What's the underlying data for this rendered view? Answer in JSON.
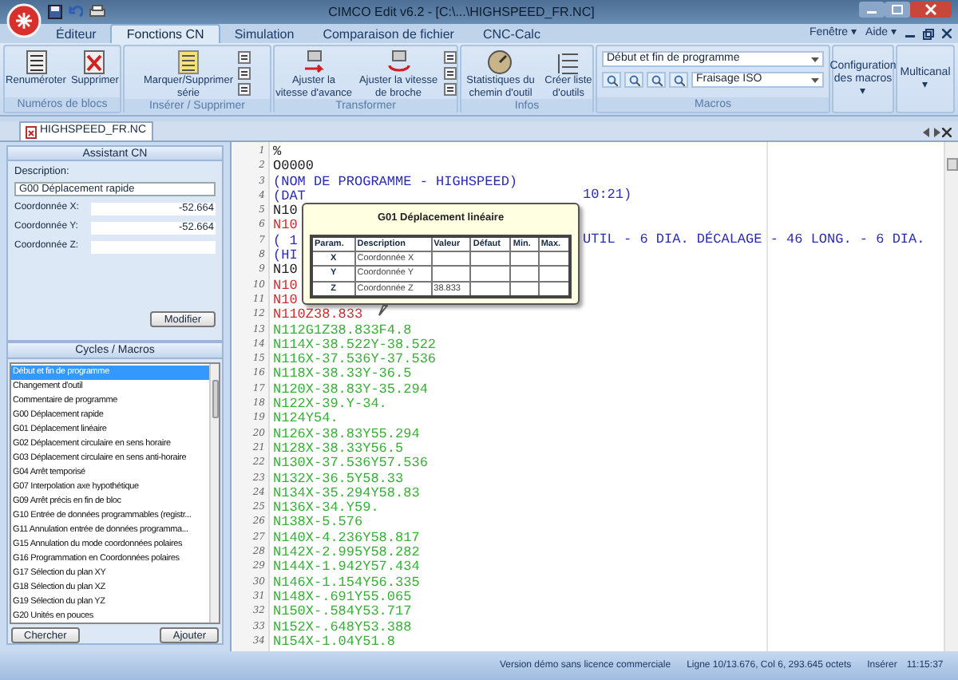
{
  "window": {
    "title": "CIMCO Edit v6.2 - [C:\\...\\HIGHSPEED_FR.NC]"
  },
  "ribbon_tabs": [
    {
      "label": "Éditeur",
      "selected": false
    },
    {
      "label": "Fonctions CN",
      "selected": true
    },
    {
      "label": "Simulation",
      "selected": false
    },
    {
      "label": "Comparaison de fichier",
      "selected": false
    },
    {
      "label": "CNC-Calc",
      "selected": false
    }
  ],
  "menu_right": [
    {
      "label": "Fenêtre ▾"
    },
    {
      "label": "Aide ▾"
    }
  ],
  "groups": [
    {
      "kind": "buttons",
      "label": "Numéros de blocs",
      "buttons": [
        "Renuméroter",
        "Supprimer"
      ]
    },
    {
      "kind": "buttons_tools",
      "label": "Insérer / Supprimer",
      "buttons": [
        "Marquer/Supprimer série"
      ]
    },
    {
      "kind": "buttons_tools",
      "label": "Transformer",
      "buttons": [
        "Ajuster la vitesse d'avance",
        "Ajuster la vitesse de broche"
      ]
    },
    {
      "kind": "buttons",
      "label": "Infos",
      "buttons": [
        "Statistiques du chemin d'outil",
        "Créer liste d'outils"
      ]
    },
    {
      "kind": "macros",
      "label": "Macros",
      "dropdown_1": "Début et fin de programme",
      "dropdown_2": "Fraisage ISO"
    },
    {
      "kind": "big",
      "label": "Configuration des macros ▾"
    },
    {
      "kind": "big",
      "label": "Multicanal ▾"
    }
  ],
  "doc_tab": {
    "label": "HIGHSPEED_FR.NC"
  },
  "assistant": {
    "title": "Assistant CN",
    "description_label": "Description:",
    "description": "G00 Déplacement rapide",
    "fields": [
      {
        "label": "Coordonnée X:",
        "value": "-52.664"
      },
      {
        "label": "Coordonnée Y:",
        "value": "-52.664"
      },
      {
        "label": "Coordonnée Z:"
      }
    ],
    "button": "Modifier"
  },
  "macros_panel": {
    "title": "Cycles / Macros",
    "items": [
      {
        "label": "Début et fin de programme",
        "selected": true
      },
      {
        "label": "Changement d'outil",
        "selected": false
      },
      {
        "label": "Commentaire de programme",
        "selected": false
      },
      {
        "label": "G00 Déplacement rapide",
        "selected": false
      },
      {
        "label": "G01 Déplacement linéaire",
        "selected": false
      },
      {
        "label": "G02 Déplacement circulaire en sens horaire",
        "selected": false
      },
      {
        "label": "G03 Déplacement circulaire en sens anti-horaire",
        "selected": false
      },
      {
        "label": "G04 Arrêt temporisé",
        "selected": false
      },
      {
        "label": "G07 Interpolation axe hypothétique",
        "selected": false
      },
      {
        "label": "G09 Arrêt précis en fin de bloc",
        "selected": false
      },
      {
        "label": "G10 Entrée de données programmables (registr...",
        "selected": false
      },
      {
        "label": "G11 Annulation entrée de données programma...",
        "selected": false
      },
      {
        "label": "G15 Annulation du mode coordonnées polaires",
        "selected": false
      },
      {
        "label": "G16 Programmation en Coordonnées polaires",
        "selected": false
      },
      {
        "label": "G17 Sélection du plan XY",
        "selected": false
      },
      {
        "label": "G18 Sélection du plan XZ",
        "selected": false
      },
      {
        "label": "G19 Sélection du plan YZ",
        "selected": false
      },
      {
        "label": "G20 Unités en pouces",
        "selected": false
      }
    ],
    "buttons": [
      "Chercher",
      "Ajouter"
    ]
  },
  "code_lines": [
    {
      "num": "1",
      "text": "%",
      "color": "#202020"
    },
    {
      "num": "2",
      "text": "O0000",
      "color": "#202020"
    },
    {
      "num": "3",
      "text": "(NOM DE PROGRAMME - HIGHSPEED)",
      "color": "#2a2ab8"
    },
    {
      "num": "4",
      "text": "(DAT",
      "tail": "10:21)",
      "color": "#2a2ab8"
    },
    {
      "num": "5",
      "text": "N10",
      "color": "#202020"
    },
    {
      "num": "6",
      "text": "N10",
      "color": "#c83030"
    },
    {
      "num": "7",
      "text": "( 1",
      "tail": "UTIL - 6 DIA. DÉCALAGE - 46 LONG. - 6 DIA.",
      "color": "#2a2ab8"
    },
    {
      "num": "8",
      "text": "(HI",
      "color": "#2a2ab8"
    },
    {
      "num": "9",
      "text": "N10",
      "color": "#202020"
    },
    {
      "num": "10",
      "text": "N10",
      "color": "#c83030"
    },
    {
      "num": "11",
      "text": "N10",
      "color": "#c83030"
    },
    {
      "num": "12",
      "text": "N110Z38.833",
      "color": "#c83030"
    },
    {
      "num": "13",
      "text": "N112G1Z38.833F4.8",
      "color": "#38b038"
    },
    {
      "num": "14",
      "text": "N114X-38.522Y-38.522",
      "color": "#38b038"
    },
    {
      "num": "15",
      "text": "N116X-37.536Y-37.536",
      "color": "#38b038"
    },
    {
      "num": "16",
      "text": "N118X-38.33Y-36.5",
      "color": "#38b038"
    },
    {
      "num": "17",
      "text": "N120X-38.83Y-35.294",
      "color": "#38b038"
    },
    {
      "num": "18",
      "text": "N122X-39.Y-34.",
      "color": "#38b038"
    },
    {
      "num": "19",
      "text": "N124Y54.",
      "color": "#38b038"
    },
    {
      "num": "20",
      "text": "N126X-38.83Y55.294",
      "color": "#38b038"
    },
    {
      "num": "21",
      "text": "N128X-38.33Y56.5",
      "color": "#38b038"
    },
    {
      "num": "22",
      "text": "N130X-37.536Y57.536",
      "color": "#38b038"
    },
    {
      "num": "23",
      "text": "N132X-36.5Y58.33",
      "color": "#38b038"
    },
    {
      "num": "24",
      "text": "N134X-35.294Y58.83",
      "color": "#38b038"
    },
    {
      "num": "25",
      "text": "N136X-34.Y59.",
      "color": "#38b038"
    },
    {
      "num": "26",
      "text": "N138X-5.576",
      "color": "#38b038"
    },
    {
      "num": "27",
      "text": "N140X-4.236Y58.817",
      "color": "#38b038"
    },
    {
      "num": "28",
      "text": "N142X-2.995Y58.282",
      "color": "#38b038"
    },
    {
      "num": "29",
      "text": "N144X-1.942Y57.434",
      "color": "#38b038"
    },
    {
      "num": "30",
      "text": "N146X-1.154Y56.335",
      "color": "#38b038"
    },
    {
      "num": "31",
      "text": "N148X-.691Y55.065",
      "color": "#38b038"
    },
    {
      "num": "32",
      "text": "N150X-.584Y53.717",
      "color": "#38b038"
    },
    {
      "num": "33",
      "text": "N152X-.648Y53.388",
      "color": "#38b038"
    },
    {
      "num": "34",
      "text": "N154X-1.04Y51.8",
      "color": "#38b038"
    }
  ],
  "tooltip": {
    "title": "G01 Déplacement linéaire",
    "columns": [
      "Param.",
      "Description",
      "Valeur",
      "Défaut",
      "Min.",
      "Max."
    ],
    "rows": [
      [
        "X",
        "Coordonnée X",
        "",
        "",
        "",
        ""
      ],
      [
        "Y",
        "Coordonnée Y",
        "",
        "",
        "",
        ""
      ],
      [
        "Z",
        "Coordonnée Z",
        "38.833",
        "",
        "",
        ""
      ]
    ]
  },
  "status_bar": {
    "notice": "Version démo sans licence commerciale",
    "position": "Ligne 10/13.676, Col 6, 293.645 octets",
    "mode": "Insérer",
    "time": "11:15:37"
  }
}
